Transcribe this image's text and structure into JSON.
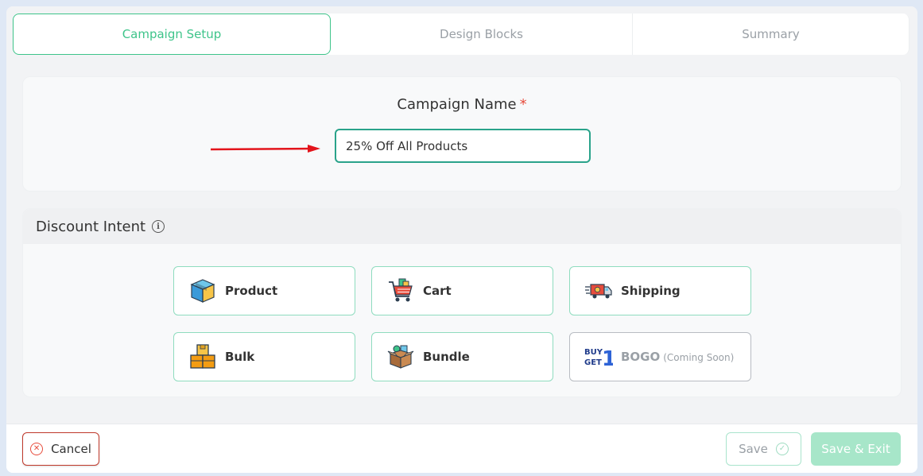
{
  "tabs": [
    {
      "label": "Campaign Setup",
      "active": true
    },
    {
      "label": "Design Blocks",
      "active": false
    },
    {
      "label": "Summary",
      "active": false
    }
  ],
  "campaign_name": {
    "label": "Campaign Name",
    "required_marker": "*",
    "value": "25% Off All Products"
  },
  "discount_intent": {
    "title": "Discount Intent",
    "options": [
      {
        "label": "Product",
        "icon": "product-box-icon"
      },
      {
        "label": "Cart",
        "icon": "shopping-cart-icon"
      },
      {
        "label": "Shipping",
        "icon": "delivery-truck-icon"
      },
      {
        "label": "Bulk",
        "icon": "stacked-boxes-icon"
      },
      {
        "label": "Bundle",
        "icon": "bundle-box-icon"
      },
      {
        "label": "BOGO",
        "suffix": "(Coming Soon)",
        "icon": "buy-get-one-icon",
        "disabled": true
      }
    ]
  },
  "footer": {
    "cancel_label": "Cancel",
    "save_label": "Save",
    "save_exit_label": "Save & Exit"
  },
  "colors": {
    "accent": "#3ec48a",
    "input_border": "#2aa38a",
    "danger": "#e74c3c",
    "save_exit_bg": "#a7e6c9"
  }
}
